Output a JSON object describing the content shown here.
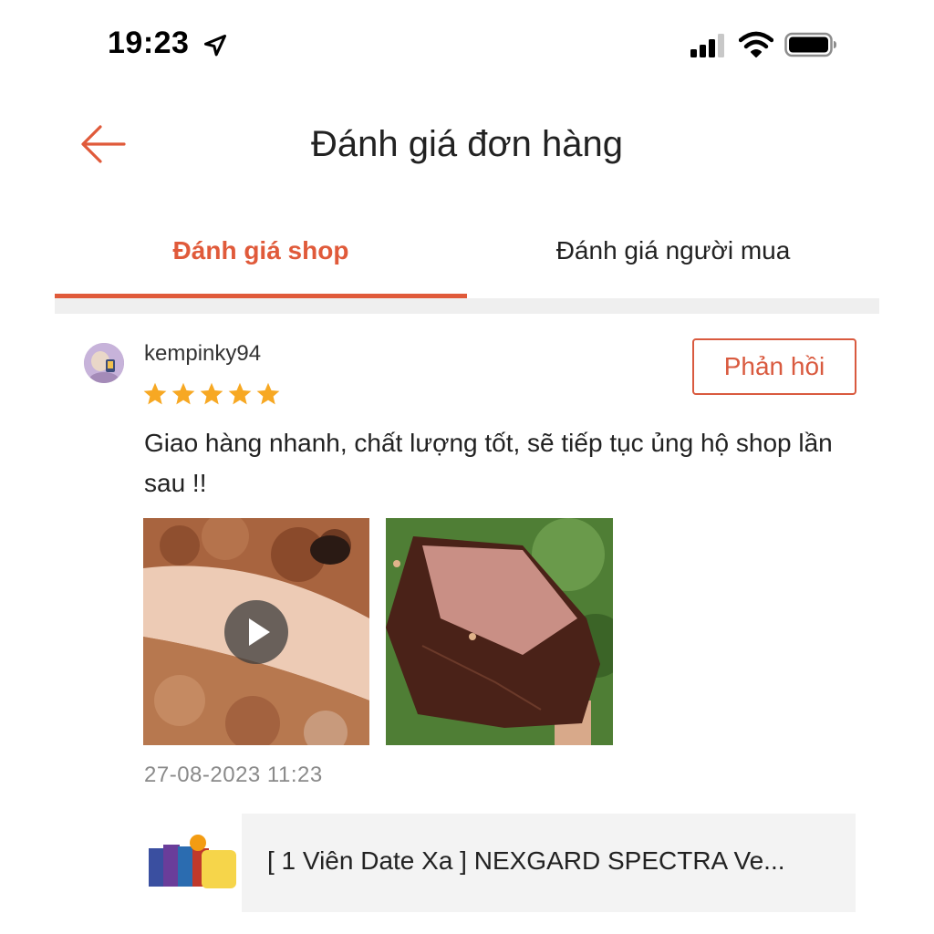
{
  "status_bar": {
    "time": "19:23"
  },
  "header": {
    "title": "Đánh giá đơn hàng"
  },
  "tabs": [
    {
      "label": "Đánh giá shop",
      "active": true
    },
    {
      "label": "Đánh giá người mua",
      "active": false
    }
  ],
  "review": {
    "username": "kempinky94",
    "rating": 5,
    "reply_label": "Phản hồi",
    "text": "Giao hàng nhanh, chất lượng tốt, sẽ tiếp tục ủng hộ shop lần sau !!",
    "date": "27-08-2023 11:23"
  },
  "product": {
    "name": "[ 1 Viên Date Xa ] NEXGARD SPECTRA Ve..."
  },
  "colors": {
    "accent": "#e05a3a",
    "star": "#f7a823"
  }
}
